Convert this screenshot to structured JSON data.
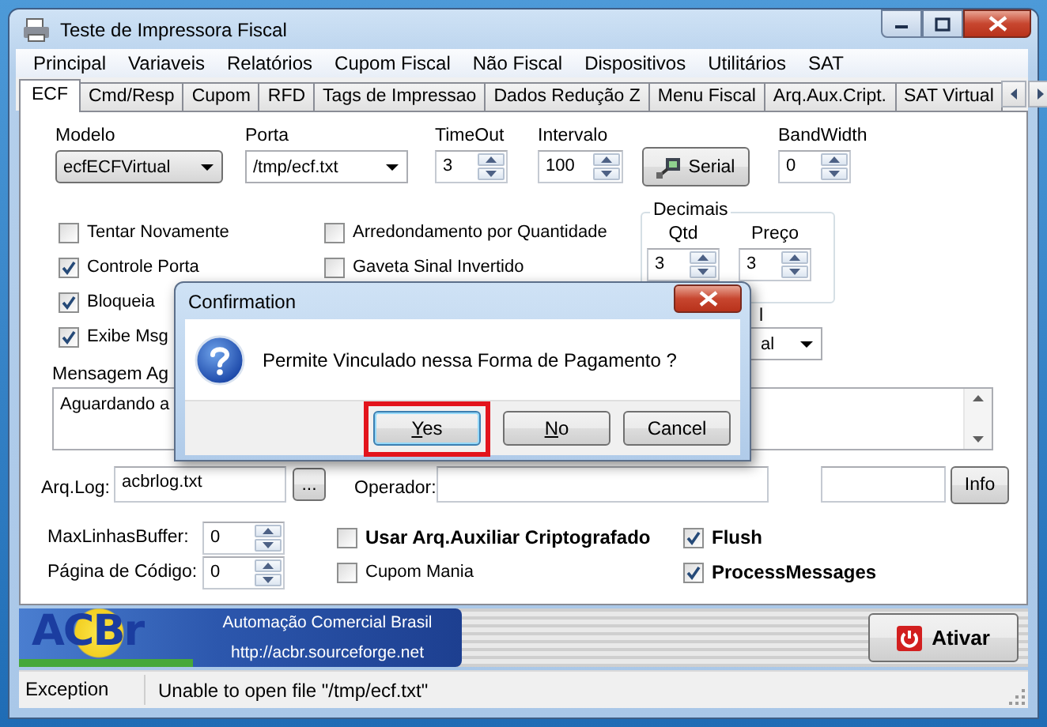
{
  "window": {
    "title": "Teste de Impressora Fiscal"
  },
  "menu": [
    "Principal",
    "Variaveis",
    "Relatórios",
    "Cupom Fiscal",
    "Não Fiscal",
    "Dispositivos",
    "Utilitários",
    "SAT"
  ],
  "tabs": [
    {
      "label": "ECF",
      "selected": true
    },
    {
      "label": "Cmd/Resp",
      "selected": false
    },
    {
      "label": "Cupom",
      "selected": false
    },
    {
      "label": "RFD",
      "selected": false
    },
    {
      "label": "Tags de Impressao",
      "selected": false
    },
    {
      "label": "Dados Redução Z",
      "selected": false
    },
    {
      "label": "Menu Fiscal",
      "selected": false
    },
    {
      "label": "Arq.Aux.Cript.",
      "selected": false
    },
    {
      "label": "SAT Virtual",
      "selected": false
    }
  ],
  "settings": [
    {
      "kind": "combo",
      "label": "Modelo",
      "value": "ecfECFVirtual"
    },
    {
      "kind": "combo",
      "label": "Porta",
      "value": "/tmp/ecf.txt"
    },
    {
      "kind": "spin",
      "label": "TimeOut",
      "value": "3"
    },
    {
      "kind": "spin",
      "label": "Intervalo",
      "value": "100"
    },
    {
      "kind": "button",
      "label": "Serial"
    },
    {
      "kind": "spin",
      "label": "BandWidth",
      "value": "0"
    }
  ],
  "options_left": [
    {
      "label": "Tentar Novamente",
      "checked": false
    },
    {
      "label": "Controle Porta",
      "checked": true
    },
    {
      "label": "Bloqueia",
      "checked": true
    },
    {
      "label": "Exibe Msg",
      "checked": true
    }
  ],
  "options_middle": [
    {
      "label": "Arredondamento por Quantidade",
      "checked": false
    },
    {
      "label": "Gaveta Sinal Invertido",
      "checked": false
    }
  ],
  "decimais": {
    "title": "Decimais",
    "fields": [
      {
        "label": "Qtd",
        "value": "3"
      },
      {
        "label": "Preço",
        "value": "3"
      }
    ]
  },
  "partial_field": {
    "label": "l",
    "value": "al"
  },
  "message": {
    "label": "Mensagem Ag",
    "value": "Aguardando a"
  },
  "log_row": {
    "label": "Arq.Log:",
    "value": "acbrlog.txt",
    "browse_button": "...",
    "operator_label": "Operador:",
    "info_button": "Info"
  },
  "advanced": [
    {
      "label": "MaxLinhasBuffer:",
      "value": "0",
      "options": [
        {
          "label": "Usar Arq.Auxiliar Criptografado",
          "checked": false
        },
        {
          "label": "Flush",
          "checked": true
        }
      ]
    },
    {
      "label": "Página de Código:",
      "value": "0",
      "options": [
        {
          "label": "Cupom Mania",
          "checked": false
        },
        {
          "label": "ProcessMessages",
          "checked": true
        }
      ]
    }
  ],
  "banner": {
    "logo": "ACBr",
    "tagline": "Automação Comercial Brasil",
    "url": "http://acbr.sourceforge.net"
  },
  "activate_button": "Ativar",
  "status_bar": [
    "Exception",
    "Unable to open file \"/tmp/ecf.txt\""
  ],
  "dialog": {
    "title": "Confirmation",
    "message": "Permite Vinculado nessa Forma de Pagamento ?",
    "buttons": [
      {
        "label": "Yes",
        "mnemonic": true,
        "selected": true,
        "highlighted": true
      },
      {
        "label": "No",
        "mnemonic": true,
        "selected": false,
        "highlighted": false
      },
      {
        "label": "Cancel",
        "mnemonic": false,
        "selected": false,
        "highlighted": false
      }
    ]
  }
}
